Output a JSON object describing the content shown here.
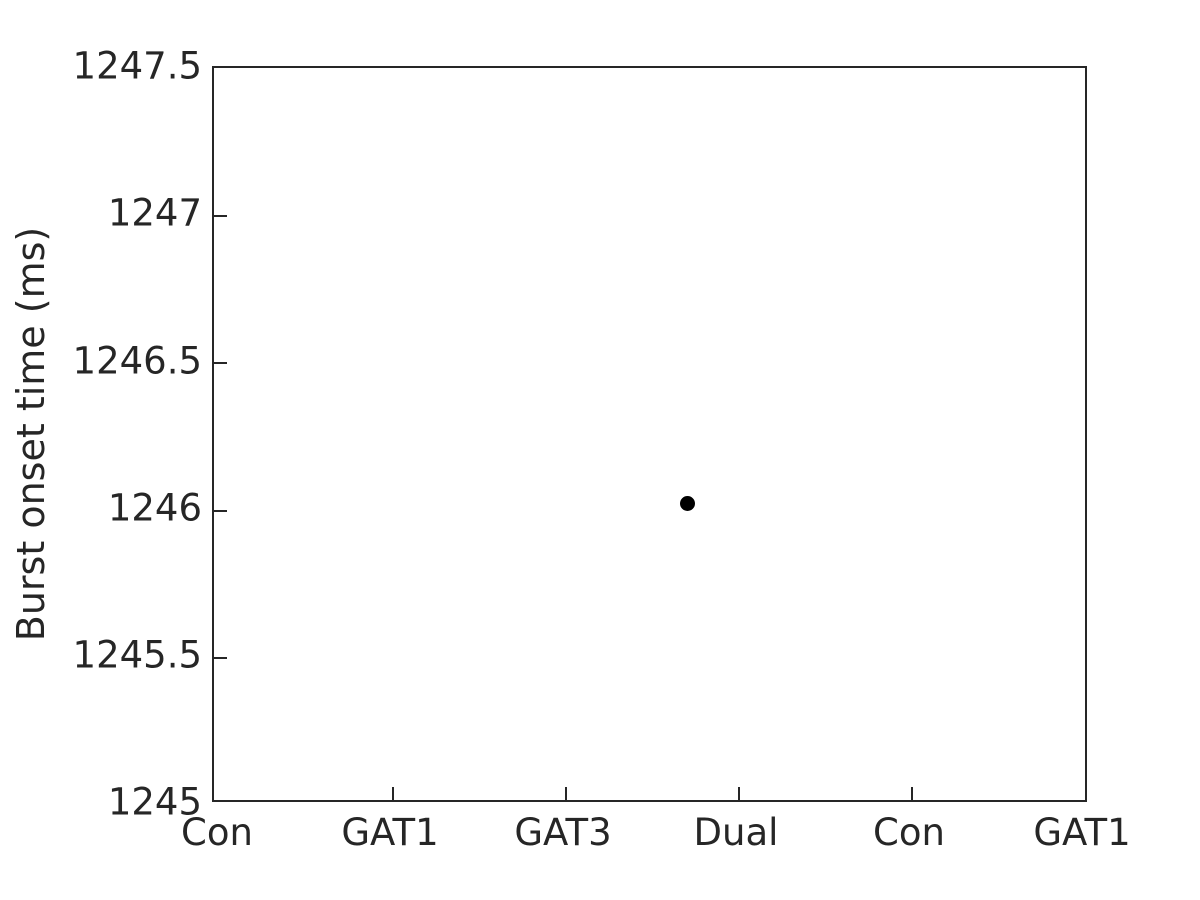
{
  "chart_data": {
    "type": "scatter",
    "title": "",
    "xlabel": "",
    "ylabel": "Burst onset time (ms)",
    "categories": [
      "Con",
      "GAT1",
      "GAT3",
      "Dual",
      "Con",
      "GAT1"
    ],
    "xtick_labels": [
      "Con",
      "GAT1",
      "GAT3",
      "Dual",
      "Con",
      "GAT1"
    ],
    "ytick_labels": [
      "1245",
      "1245.5",
      "1246",
      "1246.5",
      "1247",
      "1247.5"
    ],
    "ytick_values": [
      1245,
      1245.5,
      1246,
      1246.5,
      1247,
      1247.5
    ],
    "ylim": [
      1245,
      1247.5
    ],
    "xlim": [
      0.5,
      6.5
    ],
    "grid": false,
    "legend": null,
    "marker_color": "#000000",
    "marker_shape": "circle",
    "axis_color": "#262626",
    "background_color": "#ffffff",
    "points": [
      {
        "x_index": 3.75,
        "x_category": "Dual",
        "y": 1246.02
      }
    ],
    "series": [
      {
        "name": "Burst onset time",
        "x": [
          3.75
        ],
        "values": [
          1246.02
        ]
      }
    ]
  }
}
